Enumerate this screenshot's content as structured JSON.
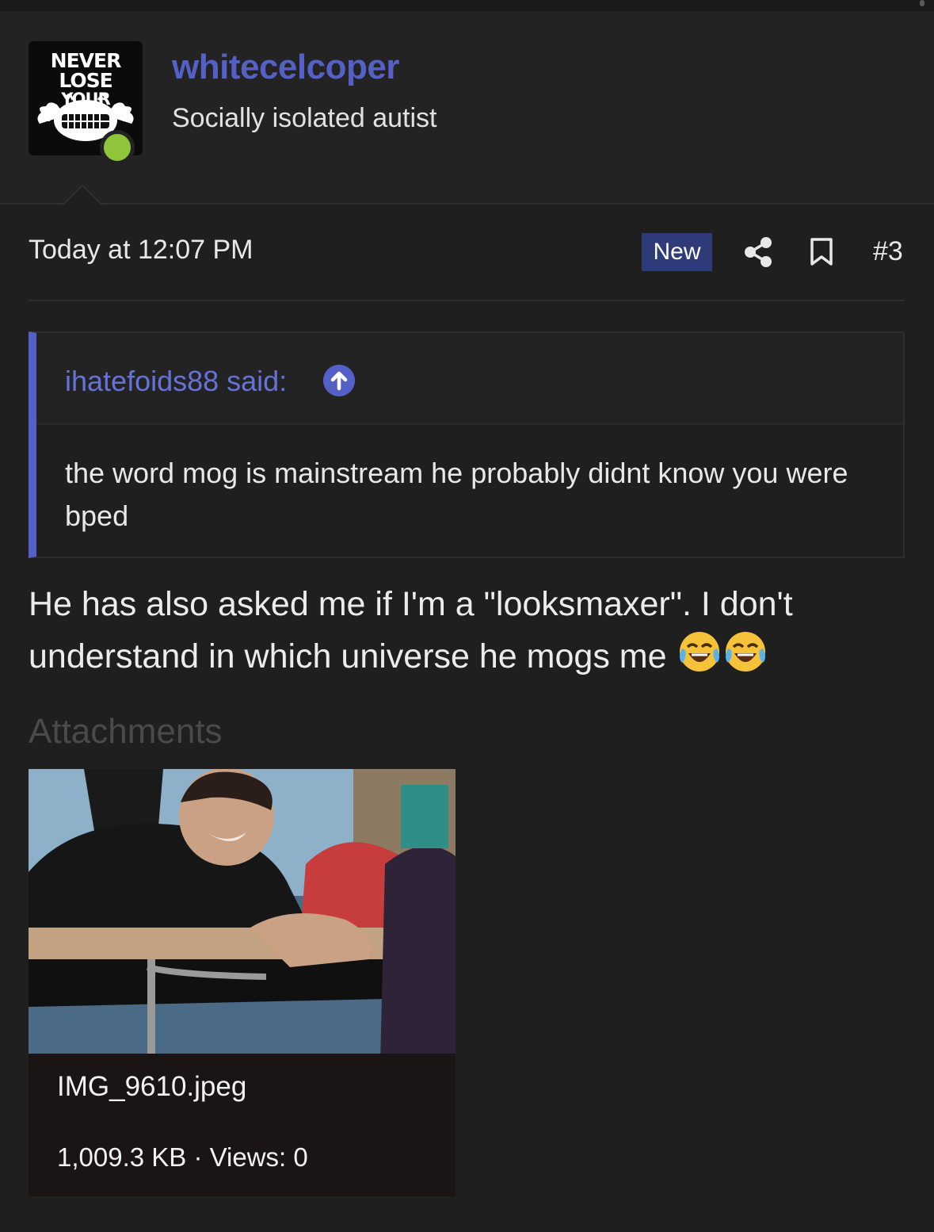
{
  "post": {
    "user": {
      "avatar_text_line1": "NEVER LOSE",
      "avatar_text_line2": "YOUR VIRGINITY",
      "username": "whitecelcoper",
      "title": "Socially isolated autist",
      "status": "online"
    },
    "timestamp": "Today at 12:07 PM",
    "badge": "New",
    "post_number": "#3",
    "quote": {
      "author": "ihatefoids88 said:",
      "text": "the word mog is mainstream he probably didnt know you were bped"
    },
    "message": "He has also asked me if I'm a \"looksmaxer\". I don't understand in which universe he mogs me",
    "emoji": [
      "face-with-tears-of-joy",
      "face-with-tears-of-joy"
    ],
    "attachments": {
      "label": "Attachments",
      "items": [
        {
          "filename": "IMG_9610.jpeg",
          "meta": "1,009.3 KB · Views: 0"
        }
      ]
    }
  },
  "colors": {
    "background": "#1f1f20",
    "accent": "#5560c6",
    "badge": "#2f3a78",
    "online": "#8fc43b"
  }
}
